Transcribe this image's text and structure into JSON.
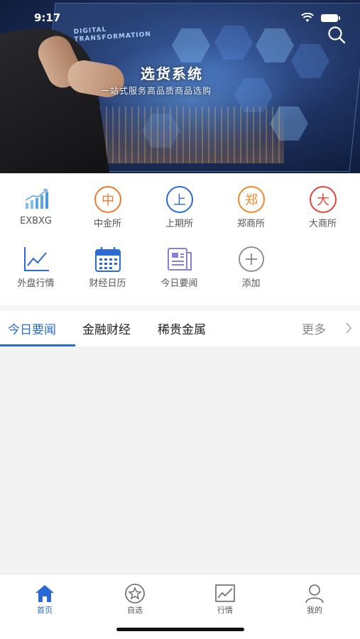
{
  "status_bar": {
    "time": "9:17"
  },
  "banner": {
    "overlay_text": "DIGITAL TRANSFORMATION",
    "title": "选货系统",
    "subtitle": "一站式服务高品质商品选购"
  },
  "quick_grid": {
    "items": [
      {
        "label": "EXBXG",
        "icon": "bar-chart-icon",
        "color": "#5aa6e8"
      },
      {
        "label": "中金所",
        "icon": "zhong-icon",
        "glyph": "中",
        "color": "#ef7a2c"
      },
      {
        "label": "上期所",
        "icon": "shang-icon",
        "glyph": "上",
        "color": "#2b6ad6"
      },
      {
        "label": "郑商所",
        "icon": "zheng-icon",
        "glyph": "郑",
        "color": "#ef8a2c"
      },
      {
        "label": "大商所",
        "icon": "da-icon",
        "glyph": "大",
        "color": "#e0463c"
      },
      {
        "label": "外盘行情",
        "icon": "line-chart-icon",
        "color": "#2b6ad6"
      },
      {
        "label": "财经日历",
        "icon": "calendar-icon",
        "color": "#2b6ad6"
      },
      {
        "label": "今日要闻",
        "icon": "news-icon",
        "color": "#8a7fd8"
      },
      {
        "label": "添加",
        "icon": "add-icon",
        "color": "#888888"
      }
    ]
  },
  "news_tabs": {
    "tabs": [
      "今日要闻",
      "金融财经",
      "稀贵金属"
    ],
    "active_index": 0,
    "more_label": "更多"
  },
  "bottom_nav": {
    "items": [
      {
        "label": "首页",
        "icon": "home-icon"
      },
      {
        "label": "自选",
        "icon": "star-icon"
      },
      {
        "label": "行情",
        "icon": "market-chart-icon"
      },
      {
        "label": "我的",
        "icon": "user-icon"
      }
    ],
    "active_index": 0
  },
  "colors": {
    "accent": "#2b6ad6",
    "background": "#f3f3f4"
  }
}
